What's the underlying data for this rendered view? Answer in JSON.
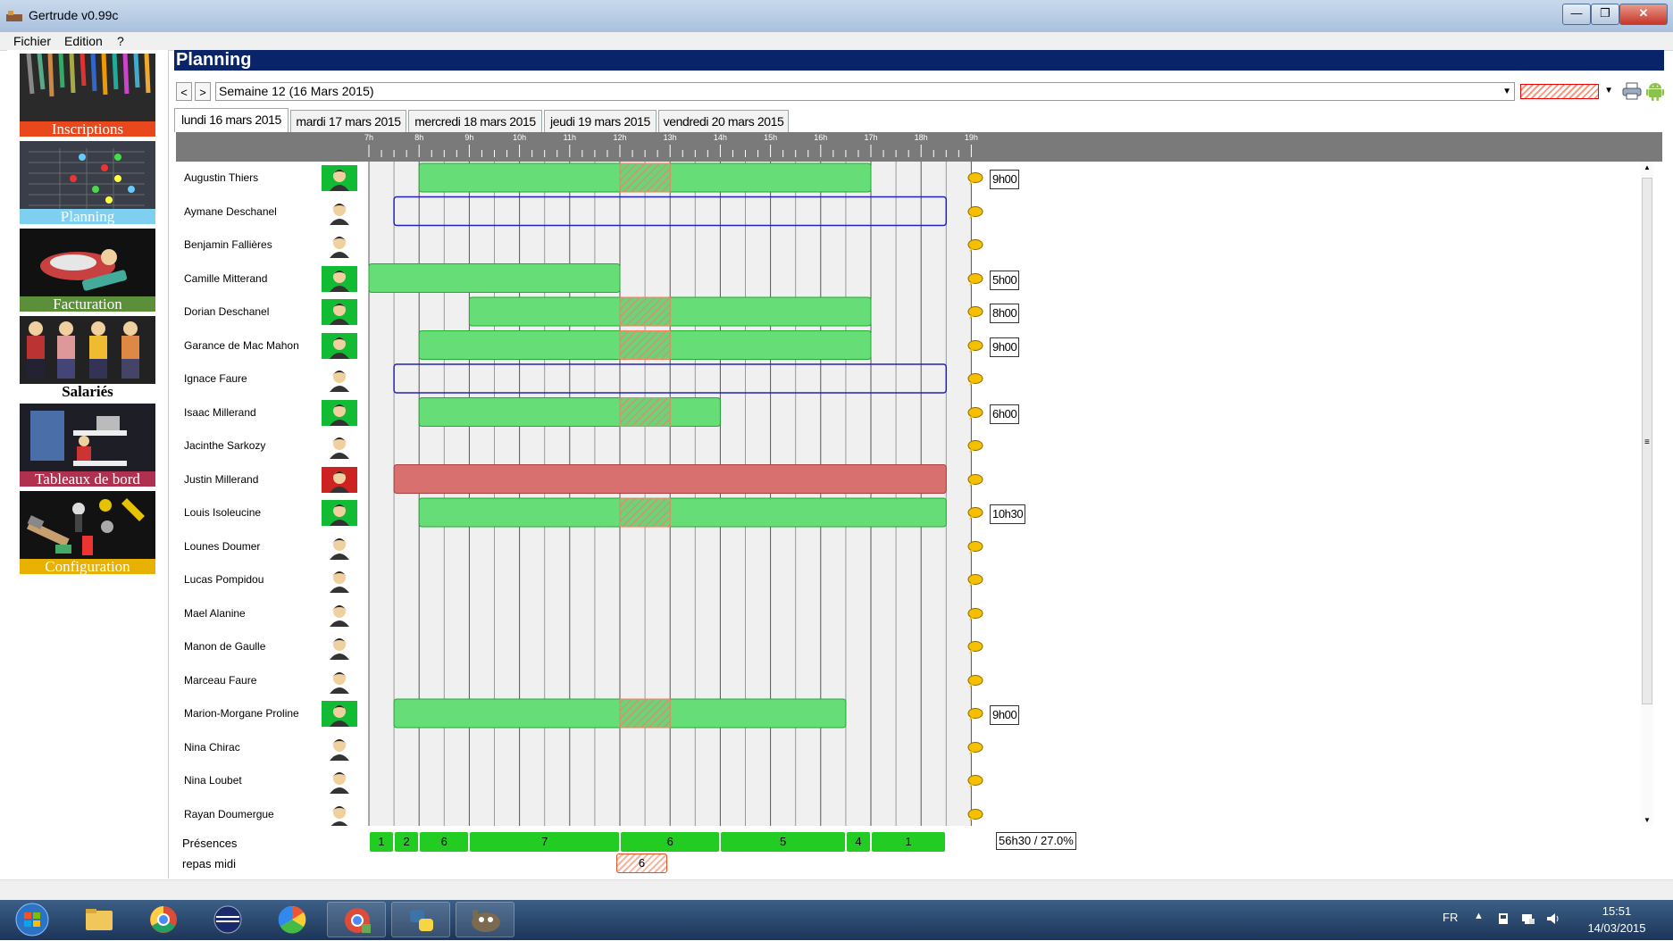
{
  "window": {
    "title": "Gertrude v0.99c",
    "minimize": "—",
    "maximize": "❐",
    "close": "✕"
  },
  "menu": [
    "Fichier",
    "Edition",
    "?"
  ],
  "sidebar": {
    "modules": [
      {
        "label": "Inscriptions",
        "color": "#e8481c"
      },
      {
        "label": "Planning",
        "color": "#7fd0f0"
      },
      {
        "label": "Facturation",
        "color": "#5b8f3a"
      },
      {
        "label": "Salariés",
        "color": "#ffffff"
      },
      {
        "label": "Tableaux de bord",
        "color": "#b03050"
      },
      {
        "label": "Configuration",
        "color": "#e8b000"
      }
    ]
  },
  "panel": {
    "title": "Planning",
    "prev_label": "<",
    "next_label": ">",
    "week_label": "Semaine 12 (16 Mars 2015)",
    "days": [
      "lundi 16 mars 2015",
      "mardi 17 mars 2015",
      "mercredi 18 mars 2015",
      "jeudi 19 mars 2015",
      "vendredi 20 mars 2015"
    ],
    "active_day": 0
  },
  "timeline": {
    "hours": [
      "7h",
      "8h",
      "9h",
      "10h",
      "11h",
      "12h",
      "13h",
      "14h",
      "15h",
      "16h",
      "17h",
      "18h",
      "19h"
    ]
  },
  "colors": {
    "presence": "#66dd77",
    "presence_border": "#22aa33",
    "absence": "#d87070",
    "planned": "#2222bb",
    "lunch": "#f08060"
  },
  "rows": [
    {
      "name": "Augustin Thiers",
      "status": "present",
      "start": 8.0,
      "end": 17.0,
      "lunch": true,
      "total": "9h00"
    },
    {
      "name": "Aymane  Deschanel",
      "status": "planned",
      "start": 7.5,
      "end": 18.5,
      "lunch": false,
      "total": ""
    },
    {
      "name": "Benjamin Fallières",
      "status": "none",
      "total": ""
    },
    {
      "name": "Camille Mitterand",
      "status": "present",
      "start": 7.0,
      "end": 12.0,
      "lunch": false,
      "total": "5h00"
    },
    {
      "name": "Dorian Deschanel",
      "status": "present",
      "start": 9.0,
      "end": 17.0,
      "lunch": true,
      "total": "8h00"
    },
    {
      "name": "Garance de Mac Mahon",
      "status": "present",
      "start": 8.0,
      "end": 17.0,
      "lunch": true,
      "total": "9h00"
    },
    {
      "name": "Ignace Faure",
      "status": "planned",
      "start": 7.5,
      "end": 18.5,
      "lunch": false,
      "total": ""
    },
    {
      "name": "Isaac Millerand",
      "status": "present",
      "start": 8.0,
      "end": 14.0,
      "lunch": true,
      "total": "6h00"
    },
    {
      "name": "Jacinthe Sarkozy",
      "status": "none",
      "total": ""
    },
    {
      "name": "Justin Millerand",
      "status": "absent",
      "start": 7.5,
      "end": 18.5,
      "lunch": false,
      "total": ""
    },
    {
      "name": "Louis Isoleucine",
      "status": "present",
      "start": 8.0,
      "end": 18.5,
      "lunch": true,
      "total": "10h30"
    },
    {
      "name": "Lounes Doumer",
      "status": "none",
      "total": ""
    },
    {
      "name": "Lucas Pompidou",
      "status": "none",
      "total": ""
    },
    {
      "name": "Mael Alanine",
      "status": "none",
      "total": ""
    },
    {
      "name": "Manon de Gaulle",
      "status": "none",
      "total": ""
    },
    {
      "name": "Marceau Faure",
      "status": "none",
      "total": ""
    },
    {
      "name": "Marion-Morgane Proline",
      "status": "present",
      "start": 7.5,
      "end": 16.5,
      "lunch": true,
      "total": "9h00"
    },
    {
      "name": "Nina Chirac",
      "status": "none",
      "total": ""
    },
    {
      "name": "Nina Loubet",
      "status": "none",
      "total": ""
    },
    {
      "name": "Rayan Doumergue",
      "status": "none",
      "total": ""
    }
  ],
  "lunch_window": {
    "start": 12.0,
    "end": 13.0
  },
  "footer": {
    "presences_label": "Présences",
    "repas_label": "repas midi",
    "presence_counts": [
      {
        "start": 7.0,
        "end": 7.5,
        "count": "1"
      },
      {
        "start": 7.5,
        "end": 8.0,
        "count": "2"
      },
      {
        "start": 8.0,
        "end": 9.0,
        "count": "6"
      },
      {
        "start": 9.0,
        "end": 12.0,
        "count": "7"
      },
      {
        "start": 12.0,
        "end": 14.0,
        "count": "6"
      },
      {
        "start": 14.0,
        "end": 16.5,
        "count": "5"
      },
      {
        "start": 16.5,
        "end": 17.0,
        "count": "4"
      },
      {
        "start": 17.0,
        "end": 18.5,
        "count": "1"
      }
    ],
    "repas_count": "6",
    "summary": "56h30 / 27.0%"
  },
  "taskbar": {
    "apps": [
      "start-orb",
      "file-explorer",
      "chrome",
      "media-player",
      "picasa",
      "chrome-app",
      "python",
      "gimp"
    ],
    "lang": "FR",
    "time": "15:51",
    "date": "14/03/2015"
  }
}
